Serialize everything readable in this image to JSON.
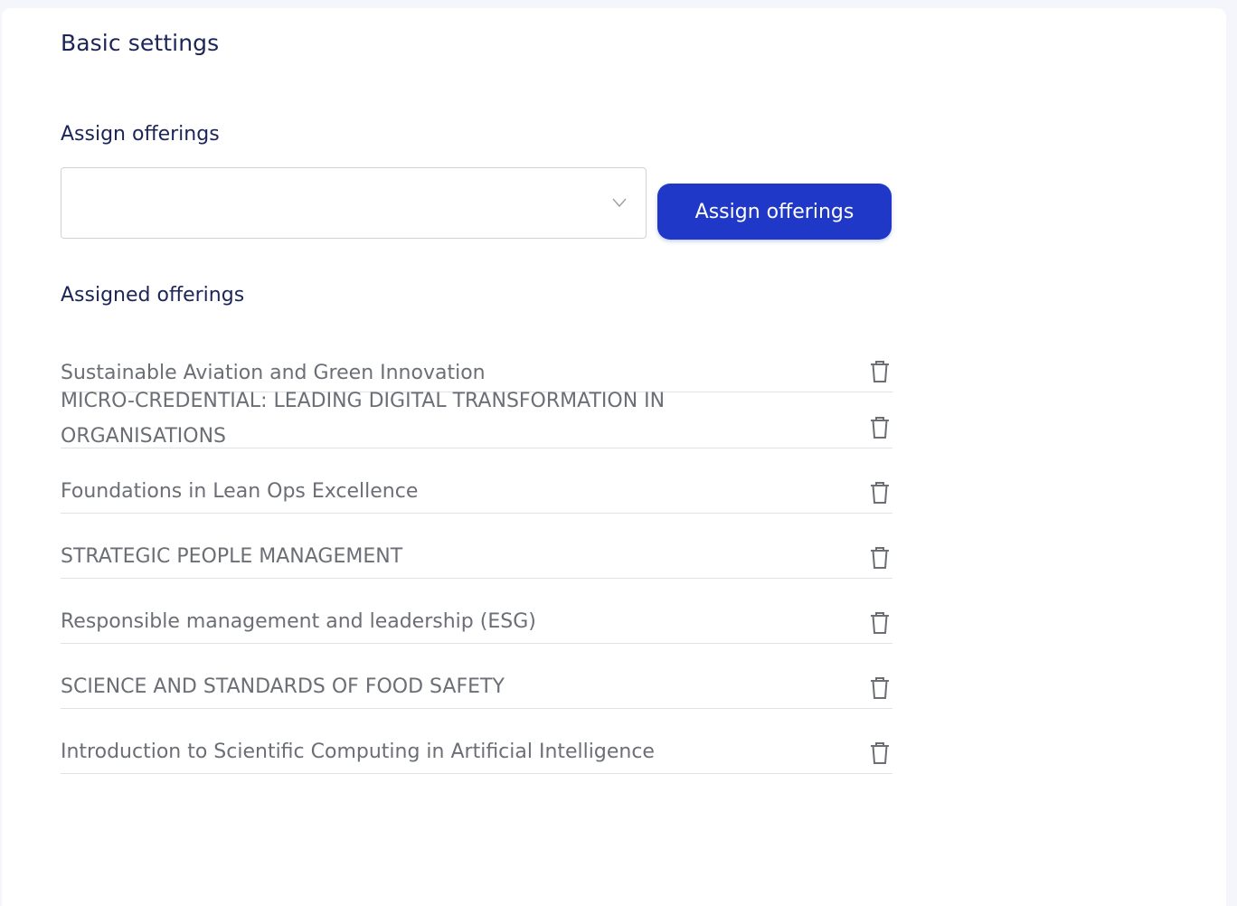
{
  "basic_settings": {
    "title": "Basic settings"
  },
  "assign": {
    "label": "Assign offerings",
    "select_value": "",
    "button_label": "Assign offerings"
  },
  "assigned": {
    "label": "Assigned offerings",
    "items": [
      {
        "title": "Sustainable Aviation and Green Innovation"
      },
      {
        "title": "MICRO-CREDENTIAL: LEADING DIGITAL TRANSFORMATION IN ORGANISATIONS"
      },
      {
        "title": "Foundations in Lean Ops Excellence"
      },
      {
        "title": "STRATEGIC PEOPLE MANAGEMENT"
      },
      {
        "title": "Responsible management and leadership (ESG)"
      },
      {
        "title": "SCIENCE AND STANDARDS OF FOOD SAFETY"
      },
      {
        "title": "Introduction to Scientific Computing in Artificial Intelligence"
      }
    ],
    "delete_icon": "trash-icon"
  },
  "colors": {
    "primary_button": "#1f38c8",
    "heading": "#1b2559",
    "item_text": "#6b6f75",
    "divider": "#dfe2e6"
  }
}
